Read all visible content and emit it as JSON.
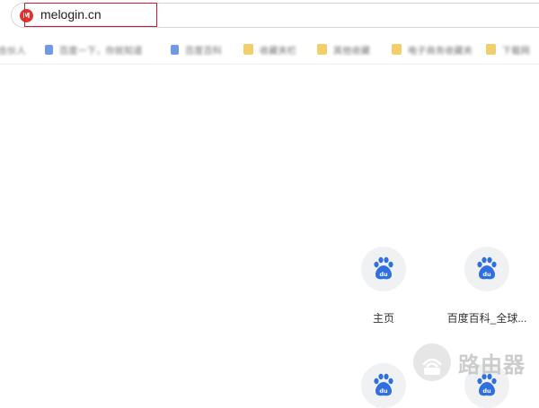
{
  "address_bar": {
    "url": "melogin.cn",
    "site_icon": "M"
  },
  "bookmarks": [
    {
      "icon": "page",
      "label": "合伙人"
    },
    {
      "icon": "page",
      "label": "百度一下，你就知道"
    },
    {
      "icon": "page",
      "label": "百度百科"
    },
    {
      "icon": "folder",
      "label": "收藏夹栏"
    },
    {
      "icon": "folder",
      "label": "其他收藏"
    },
    {
      "icon": "folder",
      "label": "电子商务收藏夹"
    },
    {
      "icon": "folder",
      "label": "下载网"
    }
  ],
  "shortcuts": [
    {
      "label": "主页",
      "icon": "baidu-paw-icon"
    },
    {
      "label": "百度百科_全球...",
      "icon": "baidu-paw-icon"
    },
    {
      "label": "",
      "icon": "baidu-paw-icon"
    },
    {
      "label": "",
      "icon": "baidu-paw-icon"
    }
  ],
  "watermark": {
    "text": "路由器"
  },
  "colors": {
    "highlight": "#c8202f",
    "baidu_blue": "#2f6fe0",
    "site_icon": "#e2322e"
  }
}
